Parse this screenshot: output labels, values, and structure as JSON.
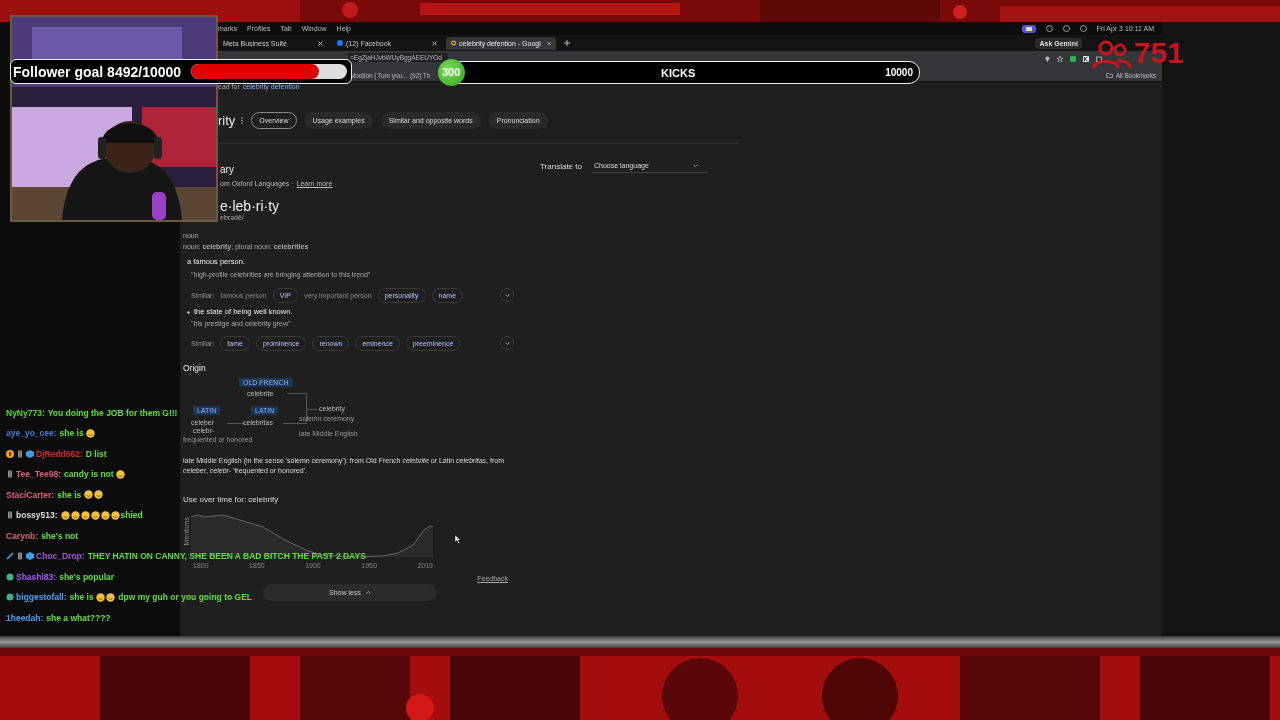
{
  "menubar": {
    "items": [
      "marks",
      "Profiles",
      "Tab",
      "Window",
      "Help"
    ],
    "clock": "Fri Apr 3  10:11 AM"
  },
  "tabs": [
    {
      "title": "Meta Business Suite",
      "selected": false
    },
    {
      "title": "(12) Facebook",
      "selected": false
    },
    {
      "title": "celebrity defention - Googl",
      "selected": true
    }
  ],
  "ask_button": "Ask Gemini",
  "address_bar": {
    "url": "=EgZjaHJvbWUyBggAEEUYOd"
  },
  "bookmarks": [
    {
      "label": "Mootion | Turn you..."
    },
    {
      "label": "(92) Th"
    }
  ],
  "all_bookmarks": "All Bookmarks",
  "search_note": {
    "prefix": "ead for",
    "link": "celebrity defention"
  },
  "result_title": "rity",
  "result_tabs": [
    {
      "label": "Overview",
      "selected": true
    },
    {
      "label": "Usage examples",
      "selected": false
    },
    {
      "label": "Similar and opposite words",
      "selected": false
    },
    {
      "label": "Pronunciation",
      "selected": false
    }
  ],
  "translate": {
    "label": "Translate to",
    "value": "Choose language"
  },
  "dictionary": {
    "heading": "ary",
    "source": "om Oxford Languages ·",
    "link": "Learn more",
    "word": "e·leb·ri·ty",
    "phonetic": "ebrədē/",
    "part_of_speech": "noun",
    "forms": "noun: **celebrity**; plural noun: **celebrities**",
    "senses": [
      {
        "bullet": false,
        "definition": "a famous person.",
        "example": "\"high-profile celebrities are bringing attention to this trend\"",
        "similar_label": "Similar:",
        "similar": [
          {
            "word": "famous person",
            "kind": "plain"
          },
          {
            "word": "VIP",
            "kind": "chip"
          },
          {
            "word": "very important person",
            "kind": "plain"
          },
          {
            "word": "personality",
            "kind": "chip"
          },
          {
            "word": "name",
            "kind": "chip"
          }
        ]
      },
      {
        "bullet": true,
        "definition": "the state of being well known.",
        "example": "\"his prestige and celebrity grew\"",
        "similar_label": "Similar:",
        "similar": [
          {
            "word": "fame",
            "kind": "chip"
          },
          {
            "word": "prominence",
            "kind": "chip"
          },
          {
            "word": "renown",
            "kind": "chip"
          },
          {
            "word": "eminence",
            "kind": "chip"
          },
          {
            "word": "preeminence",
            "kind": "chip"
          }
        ]
      }
    ]
  },
  "origin": {
    "heading": "Origin",
    "nodes": [
      {
        "kind": "tag",
        "text": "OLD FRENCH"
      },
      {
        "kind": "word",
        "text": "celebrite"
      },
      {
        "kind": "tag",
        "text": "LATIN"
      },
      {
        "kind": "tag",
        "text": "LATIN"
      },
      {
        "kind": "word",
        "text": "celebrity"
      },
      {
        "kind": "gloss",
        "text": "solemn ceremony"
      },
      {
        "kind": "word",
        "text": "celeber"
      },
      {
        "kind": "word",
        "text": "celebritas"
      },
      {
        "kind": "word",
        "text": "celebr-"
      },
      {
        "kind": "gloss",
        "text": "late Middle English"
      },
      {
        "kind": "gloss",
        "text": "frequented or honored"
      }
    ],
    "text": "late Middle English (in the sense 'solemn ceremony'): from Old French *celebrite* or Latin *celebritas*, from *celeber*, *celebr-* 'frequented or honored'."
  },
  "usage": {
    "title": "Use over time for: celebrity",
    "ylabel": "Mentions",
    "ticks": [
      "1800",
      "1850",
      "1900",
      "1950",
      "2019"
    ]
  },
  "feedback": "Feedback",
  "show_less": "Show less",
  "follower_goal": {
    "label": "Follower goal 8492/10000",
    "level": 0.82
  },
  "kicks": {
    "count": "300",
    "label": "KICKS",
    "target": "10000"
  },
  "viewers": {
    "count": "751"
  },
  "chat": [
    {
      "user": "NyNy773:",
      "color": "#55d62e",
      "parts": [
        {
          "kind": "text",
          "text": "You doing the JOB for them G!!!"
        }
      ]
    },
    {
      "user": "aye_yo_cee:",
      "color": "#3f7fd6",
      "parts": [
        {
          "kind": "text",
          "text": "she is "
        },
        {
          "kind": "emoji"
        }
      ]
    },
    {
      "user": "DjRedd662:",
      "color": "#d4243d",
      "parts": [
        {
          "kind": "text",
          "text": "D list"
        }
      ]
    },
    {
      "user": "Tee_Tee98:",
      "color": "#d9607a",
      "parts": [
        {
          "kind": "text",
          "text": "candy is not "
        },
        {
          "kind": "emoji"
        }
      ]
    },
    {
      "user": "StaciCarter:",
      "color": "#d9607a",
      "parts": [
        {
          "kind": "text",
          "text": "she is "
        },
        {
          "kind": "emoji"
        },
        {
          "kind": "emoji"
        }
      ]
    },
    {
      "user": "bossy513:",
      "color": "#dddddd",
      "parts": [
        {
          "kind": "emoji"
        },
        {
          "kind": "emoji"
        },
        {
          "kind": "emoji"
        },
        {
          "kind": "emoji"
        },
        {
          "kind": "emoji"
        },
        {
          "kind": "emoji"
        },
        {
          "kind": "text",
          "text": "shied"
        }
      ]
    },
    {
      "user": "Carynb:",
      "color": "#d9607a",
      "parts": [
        {
          "kind": "text",
          "text": "she's not"
        }
      ]
    },
    {
      "user": "Choc_Drop:",
      "color": "#9b59d6",
      "parts": [
        {
          "kind": "text",
          "text": "THEY HATIN ON CANNY, SHE BEEN A BAD BITCH THE PAST 2 DAYS"
        }
      ]
    },
    {
      "user": "Shashi83:",
      "color": "#a855f7",
      "parts": [
        {
          "kind": "text",
          "text": "she's popular"
        }
      ]
    },
    {
      "user": "biggestofall:",
      "color": "#4a9ff5",
      "parts": [
        {
          "kind": "text",
          "text": "she is "
        },
        {
          "kind": "emoji"
        },
        {
          "kind": "emoji"
        },
        {
          "kind": "text",
          "text": " dpw my guh or you going to GEL"
        }
      ]
    },
    {
      "user": "1heedah:",
      "color": "#4a9ff5",
      "parts": [
        {
          "kind": "text",
          "text": "she a what????"
        }
      ]
    }
  ]
}
